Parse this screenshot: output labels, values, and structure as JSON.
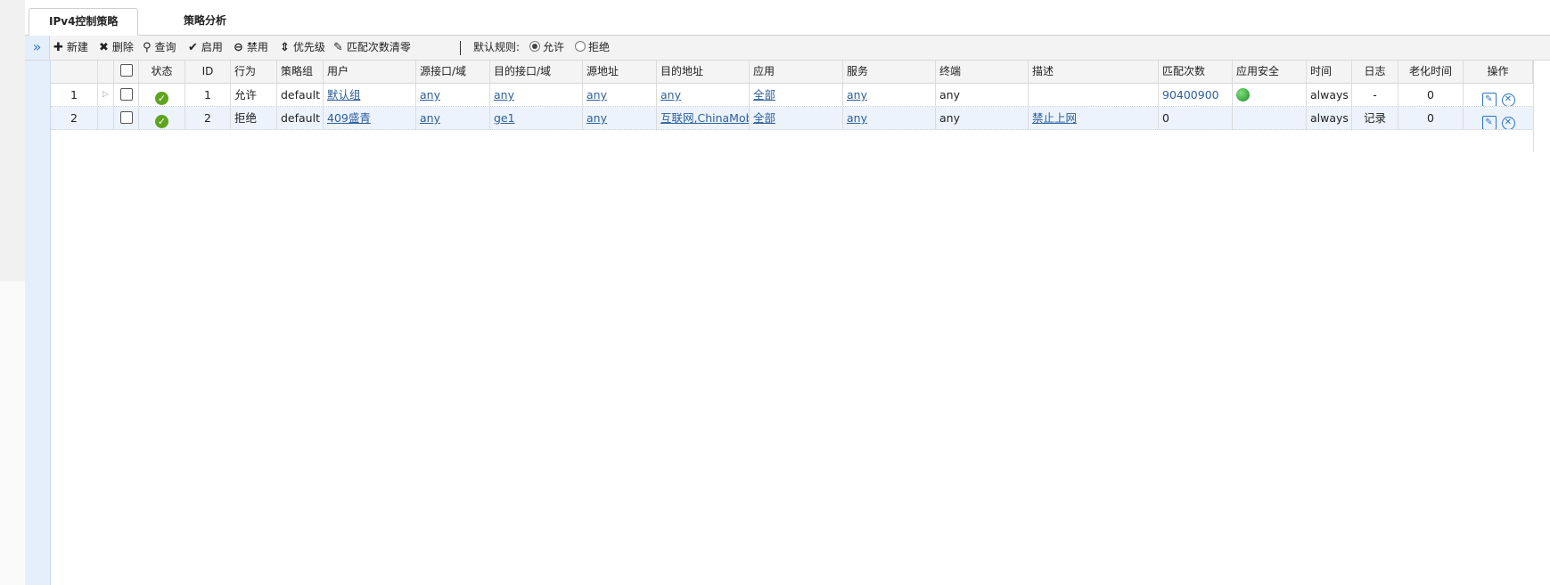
{
  "tabs": [
    {
      "label": "IPv4控制策略",
      "active": true
    },
    {
      "label": "策略分析",
      "active": false
    }
  ],
  "toolbar": {
    "collapse_icon": "»",
    "new": "新建",
    "delete": "删除",
    "query": "查询",
    "enable": "启用",
    "disable": "禁用",
    "priority": "优先级",
    "clear_matches": "匹配次数清零",
    "default_rule_label": "默认规则:",
    "allow": "允许",
    "deny": "拒绝",
    "selected_default": "allow"
  },
  "table": {
    "headers": [
      "状态",
      "ID",
      "行为",
      "策略组",
      "用户",
      "源接口/域",
      "目的接口/域",
      "源地址",
      "目的地址",
      "应用",
      "服务",
      "终端",
      "描述",
      "匹配次数",
      "应用安全",
      "时间",
      "日志",
      "老化时间",
      "操作"
    ],
    "rows": [
      {
        "index": "1",
        "expand": "▷",
        "status": "enabled",
        "id": "1",
        "action": "允许",
        "group": "default",
        "user": "默认组",
        "src_if": "any",
        "dst_if": "any",
        "src_addr": "any",
        "dst_addr": "any",
        "app": "全部",
        "service": "any",
        "terminal": "any",
        "desc": "",
        "matches": "90400900",
        "app_security": "globe-icon",
        "time": "always",
        "log": "-",
        "aging": "0"
      },
      {
        "index": "2",
        "expand": "",
        "status": "enabled",
        "id": "2",
        "action": "拒绝",
        "group": "default",
        "user": "409盛青",
        "src_if": "any",
        "dst_if": "ge1",
        "src_addr": "any",
        "dst_addr": "互联网,ChinaMobile",
        "app": "全部",
        "service": "any",
        "terminal": "any",
        "desc": "禁止上网",
        "matches": "0",
        "app_security": "",
        "time": "always",
        "log": "记录",
        "aging": "0"
      }
    ]
  },
  "colors": {
    "link": "#2e5f9c",
    "ok_green": "#5fa31e",
    "nav_blue": "#e4effb"
  }
}
